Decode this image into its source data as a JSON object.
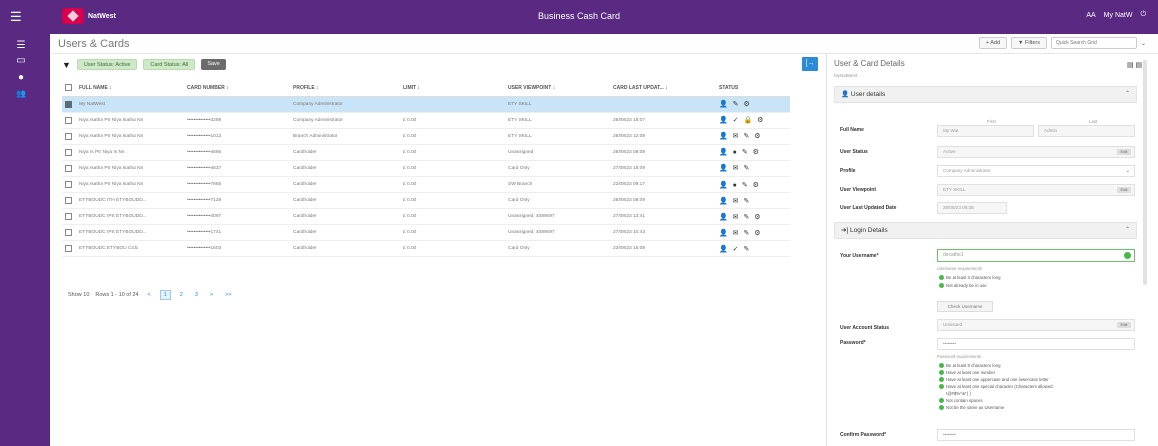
{
  "topbar": {
    "brand": "NatWest",
    "app_title": "Business Cash Card",
    "user_initials": "AA",
    "user_name": "My NatW",
    "menu_glyph": "☰",
    "power_glyph": "⏻"
  },
  "sidenav": {
    "items": [
      {
        "icon": "menu-icon",
        "glyph": "☰"
      },
      {
        "icon": "card-icon",
        "glyph": "▭"
      },
      {
        "icon": "info-icon",
        "glyph": "●"
      },
      {
        "icon": "users-icon",
        "glyph": "👥"
      }
    ]
  },
  "subheader": {
    "title": "Users & Cards",
    "add_label": "+ Add",
    "filters_label": "▼ Filters",
    "search_placeholder": "Quick Search Grid"
  },
  "filters": {
    "chips": [
      "User Status: Active",
      "Card Status: All",
      "Save"
    ]
  },
  "grid": {
    "columns": [
      "FULL NAME",
      "CARD NUMBER",
      "PROFILE",
      "LIMIT",
      "USER VIEWPOINT",
      "CARD LAST UPDAT...",
      "STATUS"
    ],
    "rows": [
      {
        "name": "My NatWest",
        "card": "",
        "profile": "Company Administrator",
        "limit": "",
        "viewpoint": "ETY SKILL",
        "updated": "",
        "status": "👤 ✎ ⚙",
        "selected": true
      },
      {
        "name": "Niya Isatha Ptr Niya Isatha Nn",
        "card": "••••••••••••••3289",
        "profile": "Company Administrator",
        "limit": "£ 0.00",
        "viewpoint": "ETY SKILL",
        "updated": "28/08/23 18:07",
        "status": "👤 ✓ 🔒 ⚙",
        "selected": false
      },
      {
        "name": "Niya Isatha Ptr Niya Isatha Nn",
        "card": "••••••••••••••1013",
        "profile": "Branch Administrator",
        "limit": "£ 0.00",
        "viewpoint": "ETY SKILL",
        "updated": "28/08/23 12:08",
        "status": "👤 ✉ ✎ ⚙",
        "selected": false
      },
      {
        "name": "Niya Is Ptr Niya Is Nn",
        "card": "••••••••••••••4666",
        "profile": "Cardholder",
        "limit": "£ 0.00",
        "viewpoint": "Unassigned",
        "updated": "28/08/23 08:08",
        "status": "👤 ● ✎ ⚙",
        "selected": false
      },
      {
        "name": "Niya Isatha Ptr Niya Isatha Nn",
        "card": "••••••••••••••4637",
        "profile": "Cardholder",
        "limit": "£ 0.00",
        "viewpoint": "Card Only",
        "updated": "27/08/23 18:09",
        "status": "👤 ✉ ✎",
        "selected": false
      },
      {
        "name": "Niya Isatha Ptr Niya Isatha Nn",
        "card": "••••••••••••••7865",
        "profile": "Cardholder",
        "limit": "£ 0.00",
        "viewpoint": "SW Branch",
        "updated": "22/08/23 09:17",
        "status": "👤 ● ✎ ⚙",
        "selected": false
      },
      {
        "name": "ETYBOUDC ITH ETYBOUDD...",
        "card": "••••••••••••••7128",
        "profile": "Cardholder",
        "limit": "£ 0.00",
        "viewpoint": "Card Only",
        "updated": "28/08/23 08:09",
        "status": "👤 ✉ ✎",
        "selected": false
      },
      {
        "name": "ETYBOUDC IPS ETYBOUDD...",
        "card": "••••••••••••••4097",
        "profile": "Cardholder",
        "limit": "£ 0.00",
        "viewpoint": "Unassigned: 4089097",
        "updated": "27/08/23 13:41",
        "status": "👤 ✉ ✎ ⚙",
        "selected": false
      },
      {
        "name": "ETYBOUDC IPS ETYBOUDD...",
        "card": "••••••••••••••1741",
        "profile": "Cardholder",
        "limit": "£ 0.00",
        "viewpoint": "Unassigned: 4089097",
        "updated": "27/08/23 10:43",
        "status": "👤 ✉ ✎ ⚙",
        "selected": false
      },
      {
        "name": "ETYBOUDC ETYBOU Crdc",
        "card": "••••••••••••••1603",
        "profile": "Cardholder",
        "limit": "£ 0.00",
        "viewpoint": "Card Only",
        "updated": "23/08/23 15:08",
        "status": "👤 ✓ ✎",
        "selected": false
      }
    ]
  },
  "pager": {
    "show_label": "Show 10",
    "rows_label": "Rows 1 - 10 of 24",
    "prev": "<",
    "pages": [
      "1",
      "2",
      "3"
    ],
    "next": ">",
    "last": ">>"
  },
  "panel": {
    "title": "User & Card Details",
    "subtitle": "MyNatWest",
    "user_details_label": "👤 User details",
    "full_name_label": "Full Name",
    "first_label": "First",
    "last_label": "Last",
    "first_value": "My Wat",
    "last_value": "Admin",
    "user_status_label": "User Status",
    "user_status_value": "Active",
    "profile_label": "Profile",
    "profile_value": "Company Administrator",
    "viewpoint_label": "User Viewpoint",
    "viewpoint_value": "ETY SKILL",
    "last_updated_label": "User Last Updated Date",
    "last_updated_value": "28/08/23 08:38",
    "login_details_label": "➔] Login Details",
    "username_label": "Your Username*",
    "username_value": "decathe1",
    "username_req_title": "Username requirements",
    "username_reqs": [
      "Be at least 3 characters long",
      "Not already be in use"
    ],
    "check_btn": "Check Username",
    "account_status_label": "User Account Status",
    "account_status_value": "Unissued",
    "password_label": "Password*",
    "password_placeholder": "••••••••",
    "password_req_title": "Password requirements",
    "password_reqs": [
      "Be at least 8 characters long",
      "Have at least one number",
      "Have at least one uppercase and one lowercase letter",
      "Have at least one special character (Characters allowed:",
      "!@#$%^&*( )",
      "Not contain spaces",
      "Not be the same as Username"
    ],
    "confirm_label": "Confirm Password*",
    "confirm_placeholder": "••••••••",
    "edit_btn": "Edit",
    "chevron": "⌃",
    "caret": "⌄",
    "action_icons": "▤ ▤"
  }
}
